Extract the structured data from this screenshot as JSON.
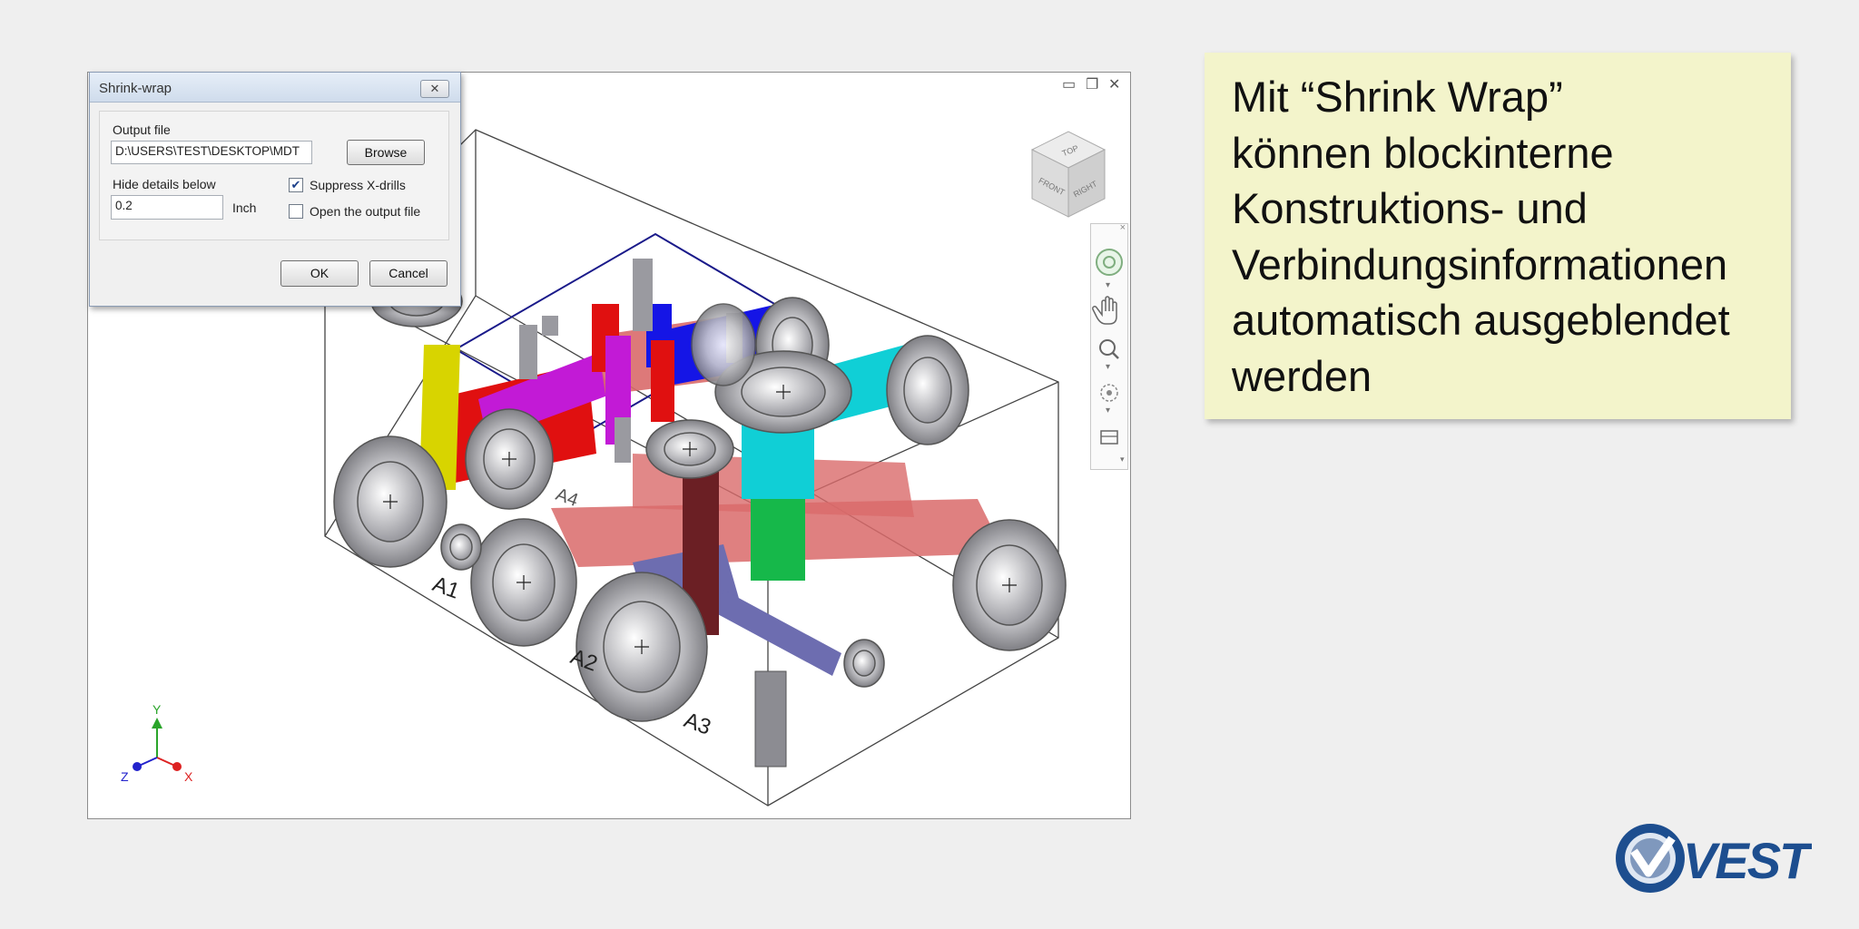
{
  "dialog": {
    "title": "Shrink-wrap",
    "close_glyph": "✕",
    "output_file_label": "Output file",
    "output_file_value": "D:\\USERS\\TEST\\DESKTOP\\MDT",
    "browse_label": "Browse",
    "hide_details_label": "Hide details below",
    "hide_details_value": "0.2",
    "unit_label": "Inch",
    "suppress_xdrills_label": "Suppress X-drills",
    "suppress_xdrills_checked": true,
    "open_output_label": "Open the output file",
    "open_output_checked": false,
    "ok_label": "OK",
    "cancel_label": "Cancel"
  },
  "viewport": {
    "window_controls": [
      "minimize-icon",
      "restore-icon",
      "close-icon"
    ],
    "viewcube": {
      "top": "TOP",
      "front": "FRONT",
      "right": "RIGHT"
    },
    "port_labels": [
      "A1",
      "A2",
      "A3",
      "A4"
    ],
    "axes": {
      "x": "X",
      "y": "Y",
      "z": "Z"
    },
    "nav_tools": [
      "steering-wheel-icon",
      "pan-icon",
      "zoom-icon",
      "orbit-icon",
      "look-icon"
    ]
  },
  "note": {
    "lines": [
      "Mit “Shrink Wrap”",
      "können blockinterne",
      "Konstruktions- und",
      "Verbindungsinformationen",
      "automatisch ausgeblendet",
      "werden"
    ]
  },
  "logo": {
    "text": "VEST"
  },
  "colors": {
    "note_bg": "#f3f4cb",
    "block_red": "#d96a6a",
    "red": "#e01010",
    "yellow": "#d8d400",
    "magenta": "#c21ad6",
    "blue": "#1515e6",
    "cyan": "#10cfd6",
    "green": "#16b84a",
    "slate_blue": "#6d6db0",
    "dark_red": "#6b1f24",
    "metal": "#a9a9ad",
    "logo_blue": "#1d4e8f"
  }
}
